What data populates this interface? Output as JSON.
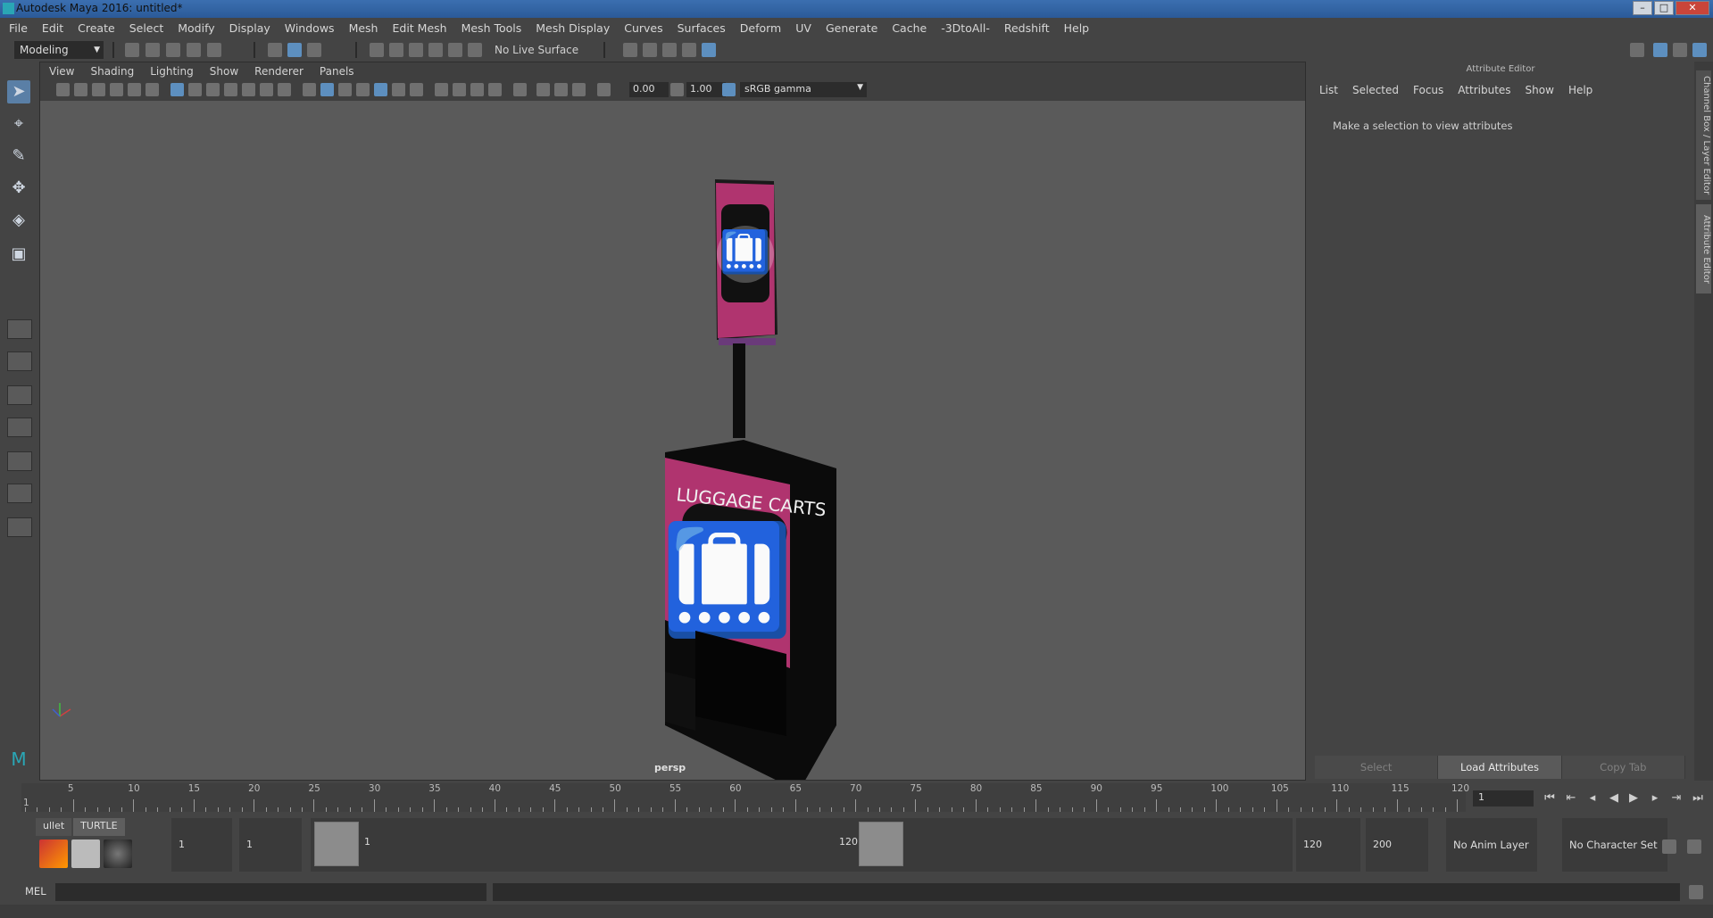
{
  "window": {
    "title": "Autodesk Maya 2016: untitled*"
  },
  "menubar": [
    "File",
    "Edit",
    "Create",
    "Select",
    "Modify",
    "Display",
    "Windows",
    "Mesh",
    "Edit Mesh",
    "Mesh Tools",
    "Mesh Display",
    "Curves",
    "Surfaces",
    "Deform",
    "UV",
    "Generate",
    "Cache",
    "-3DtoAll-",
    "Redshift",
    "Help"
  ],
  "statusline": {
    "mode": "Modeling",
    "live_surface": "No Live Surface"
  },
  "viewport": {
    "menu": [
      "View",
      "Shading",
      "Lighting",
      "Show",
      "Renderer",
      "Panels"
    ],
    "exposure": "0.00",
    "gamma": "1.00",
    "color_space": "sRGB gamma",
    "camera_label": "persp",
    "sign_text": "LUGGAGE CARTS",
    "sign_color": "#b0346f"
  },
  "attribute_editor": {
    "title": "Attribute Editor",
    "menu": [
      "List",
      "Selected",
      "Focus",
      "Attributes",
      "Show",
      "Help"
    ],
    "message": "Make a selection to view attributes",
    "buttons": {
      "select": "Select",
      "load": "Load Attributes",
      "copy": "Copy Tab"
    }
  },
  "side_tabs": {
    "channel_box": "Channel Box / Layer Editor",
    "attribute_editor": "Attribute Editor"
  },
  "timeline": {
    "ticks": [
      "5",
      "10",
      "15",
      "20",
      "25",
      "30",
      "35",
      "40",
      "45",
      "50",
      "55",
      "60",
      "65",
      "70",
      "75",
      "80",
      "85",
      "90",
      "95",
      "100",
      "105",
      "110",
      "115",
      "120"
    ],
    "start_marker": "1",
    "current_frame": "1"
  },
  "range": {
    "start": "1",
    "playback_start": "1",
    "slider_start": "1",
    "slider_end": "120",
    "playback_end": "120",
    "end": "200",
    "anim_layer": "No Anim Layer",
    "character_set": "No Character Set"
  },
  "shelf": {
    "tabs": [
      "ullet",
      "TURTLE"
    ]
  },
  "command_line": {
    "label": "MEL"
  }
}
